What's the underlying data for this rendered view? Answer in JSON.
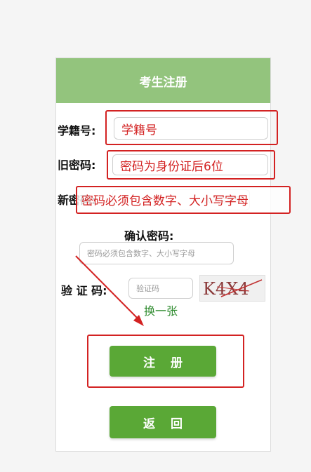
{
  "header": {
    "title": "考生注册"
  },
  "form": {
    "student_id": {
      "label": "学籍号:",
      "value": "学籍号"
    },
    "old_password": {
      "label": "旧密码:",
      "value": "密码为身份证后6位"
    },
    "new_password": {
      "label": "新密码:",
      "placeholder": "大小写字母",
      "annotation": "密码必须包含数字、大小写字母"
    },
    "confirm_password": {
      "label": "确认密码:",
      "placeholder": "密码必须包含数字、大小写字母"
    },
    "captcha": {
      "label": "验 证 码:",
      "placeholder": "验证码",
      "image_text": "K4X4",
      "refresh_label": "换一张"
    }
  },
  "buttons": {
    "register": "注册",
    "back": "返回"
  },
  "colors": {
    "header_bg": "#93c47d",
    "button_green": "#5aa836",
    "annotation_red": "#d32222",
    "link_green": "#2e8b2e"
  }
}
